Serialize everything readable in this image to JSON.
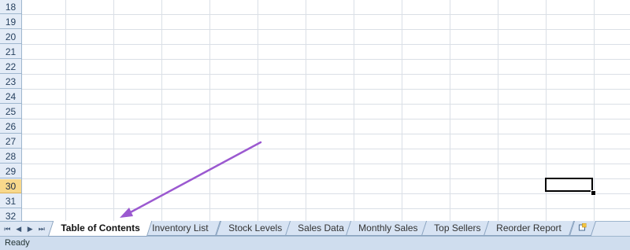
{
  "grid": {
    "rows": [
      "18",
      "19",
      "20",
      "21",
      "22",
      "23",
      "24",
      "25",
      "26",
      "27",
      "28",
      "29",
      "30",
      "31",
      "32"
    ],
    "active_row": "30"
  },
  "tab_nav": {
    "first": "⏮",
    "prev": "◀",
    "next": "▶",
    "last": "⏭"
  },
  "sheets": [
    {
      "label": "Table of Contents",
      "active": true
    },
    {
      "label": "Inventory List",
      "active": false
    },
    {
      "label": "Stock Levels",
      "active": false
    },
    {
      "label": "Sales Data",
      "active": false
    },
    {
      "label": "Monthly Sales",
      "active": false
    },
    {
      "label": "Top Sellers",
      "active": false
    },
    {
      "label": "Reorder Report",
      "active": false
    }
  ],
  "new_sheet_icon": "insert-worksheet-icon",
  "status_bar": {
    "text": "Ready"
  },
  "colors": {
    "annotation_arrow": "#9b59d0",
    "active_row_header": "#f8d88b",
    "header_bg": "#e4ecf7",
    "gridline": "#dadfe6"
  }
}
